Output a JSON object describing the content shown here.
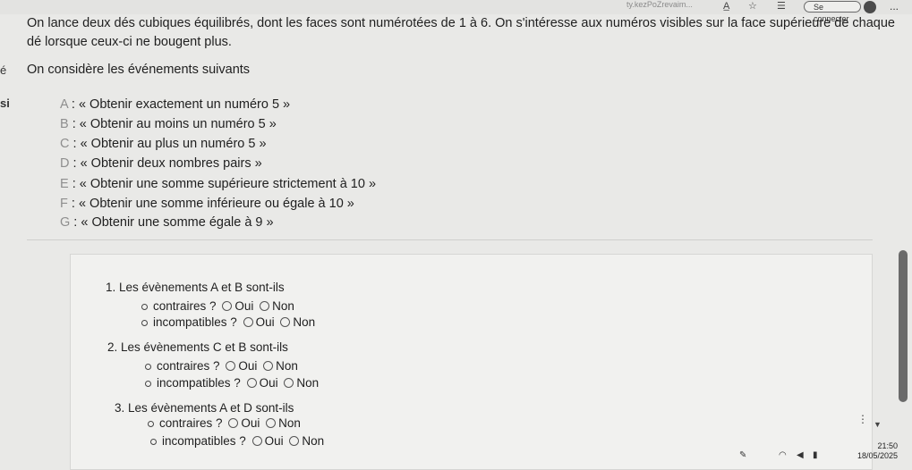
{
  "topbar": {
    "faint_url": "ty.kezPoZrevaim...",
    "signin_label": "Se connecter",
    "menu_label": "..."
  },
  "intro": {
    "line": "On lance deux dés cubiques équilibrés, dont les faces sont numérotées de 1 à 6. On s'intéresse aux numéros visibles sur la face supérieure de chaque dé lorsque ceux-ci ne bougent plus."
  },
  "left_cut": {
    "a": "é",
    "b": "si"
  },
  "heading": "On considère les événements suivants",
  "events": [
    {
      "key": "A",
      "text": " : « Obtenir exactement un numéro 5 »"
    },
    {
      "key": "B",
      "text": " : « Obtenir au moins un numéro 5 »"
    },
    {
      "key": "C",
      "text": " : « Obtenir au plus un numéro 5 »"
    },
    {
      "key": "D",
      "text": " : « Obtenir deux nombres pairs »"
    },
    {
      "key": "E",
      "text": " : « Obtenir une somme supérieure strictement à 10 »"
    },
    {
      "key": "F",
      "text": " : « Obtenir une somme inférieure ou égale à 10 »"
    },
    {
      "key": "G",
      "text": " : « Obtenir une somme égale à 9 »"
    }
  ],
  "questions": [
    {
      "title": "1. Les évènements A et B sont-ils",
      "opt1": "contraires ?",
      "opt2": "incompatibles ?"
    },
    {
      "title": "2. Les évènements C et B sont-ils",
      "opt1": "contraires ?",
      "opt2": "incompatibles ?"
    },
    {
      "title": "3. Les évènements A et D sont-ils",
      "opt1": "contraires ?",
      "opt2": "incompatibles ?"
    }
  ],
  "answers": {
    "yes": "Oui",
    "no": "Non"
  },
  "clock": {
    "time": "21:50",
    "date": "18/05/2025"
  }
}
